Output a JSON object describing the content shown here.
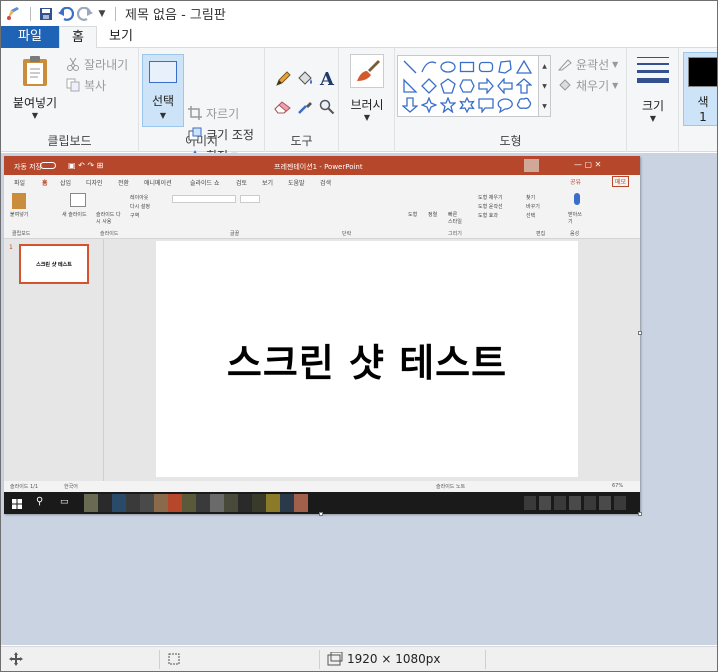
{
  "window": {
    "title": "제목 없음 - 그림판"
  },
  "tabs": {
    "file": "파일",
    "home": "홈",
    "view": "보기"
  },
  "clipboard": {
    "paste": "붙여넣기",
    "cut": "잘라내기",
    "copy": "복사",
    "label": "클립보드"
  },
  "image": {
    "select": "선택",
    "crop": "자르기",
    "resize": "크기 조정",
    "rotate": "회전",
    "label": "이미지"
  },
  "tools": {
    "label": "도구",
    "text_tool": "A"
  },
  "brushes": {
    "label": "브러시"
  },
  "shapes": {
    "outline": "윤곽선",
    "fill": "채우기",
    "label": "도형"
  },
  "size": {
    "label": "크기"
  },
  "colors": {
    "color1_label": "색",
    "color1_num": "1",
    "color1_value": "#000000"
  },
  "icons": {
    "app": "paint-app-icon",
    "save": "save-icon",
    "undo": "undo-icon",
    "redo": "redo-icon",
    "paste": "clipboard-paste-icon",
    "cut": "scissors-icon",
    "copy": "copy-icon",
    "select": "selection-rectangle-icon",
    "crop": "crop-icon",
    "resize": "resize-icon",
    "rotate": "rotate-icon",
    "pencil": "pencil-icon",
    "fill": "paint-bucket-icon",
    "text": "text-icon",
    "eraser": "eraser-icon",
    "picker": "color-picker-icon",
    "magnifier": "magnifier-icon",
    "brushes": "brush-icon",
    "size": "line-size-icon",
    "move": "move-cursor-icon",
    "selection": "selection-size-icon",
    "image_size": "image-size-icon"
  },
  "accent": "#1e63b5",
  "canvas": {
    "pp_title": "프레젠테이션1 - PowerPoint",
    "pp_autosave": "자동 저장",
    "pp_tabs": [
      "파일",
      "홈",
      "삽입",
      "디자인",
      "전환",
      "애니메이션",
      "슬라이드 쇼",
      "검토",
      "보기",
      "도움말",
      "검색"
    ],
    "pp_share": "공유",
    "pp_memo": "메모",
    "pp_groups": [
      "클립보드",
      "슬라이드",
      "글꼴",
      "단락",
      "그리기",
      "편집",
      "음성"
    ],
    "pp_new_slide": "새 슬라이드",
    "pp_reuse": "슬라이드 다시 사용",
    "pp_layout": "레이아웃",
    "pp_reset": "다시 설정",
    "pp_section": "구역",
    "pp_arrange": "정렬",
    "pp_quick": "빠른 스타일",
    "pp_find": "찾기",
    "pp_replace": "바꾸기",
    "pp_select": "선택",
    "pp_dictate": "받아쓰기",
    "pp_shape_fill": "도형 채우기",
    "pp_shape_outline": "도형 윤곽선",
    "pp_shape_effect": "도형 효과",
    "pp_shape": "도형",
    "pp_paste": "붙여넣기",
    "pp_slide_num": "1",
    "slide_text": "스크린 샷 테스트",
    "pp_status_left": "슬라이드 1/1",
    "pp_lang": "한국어",
    "pp_notes": "슬라이드 노트",
    "pp_zoom": "67%"
  },
  "status": {
    "image_size": "1920 × 1080px"
  }
}
